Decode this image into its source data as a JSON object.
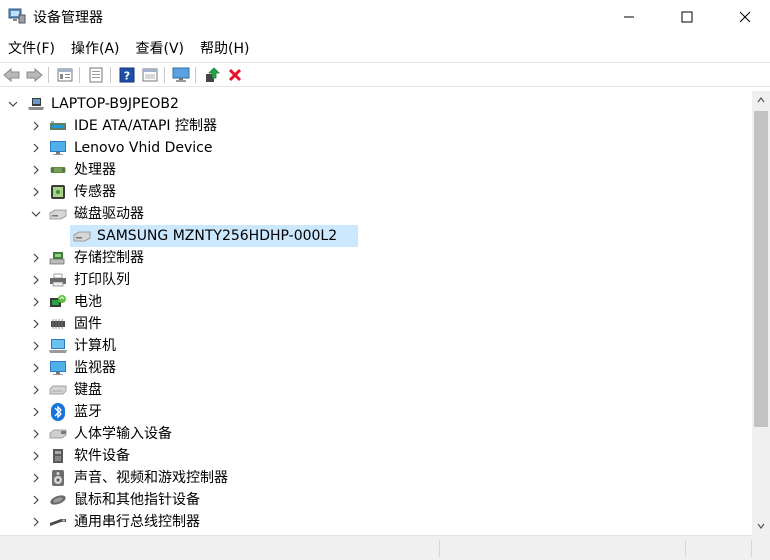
{
  "window": {
    "title": "设备管理器"
  },
  "menu": [
    "文件(F)",
    "操作(A)",
    "查看(V)",
    "帮助(H)"
  ],
  "toolbar_icons": [
    "back-arrow-icon",
    "forward-arrow-icon",
    "properties-icon",
    "show-hide-icon",
    "help-icon",
    "view-icon",
    "computer-icon",
    "update-driver-icon",
    "uninstall-icon"
  ],
  "tree": {
    "root": "LAPTOP-B9JPEOB2",
    "items": [
      {
        "label": "IDE ATA/ATAPI 控制器",
        "icon": "ide-controller-icon",
        "expanded": false
      },
      {
        "label": "Lenovo Vhid Device",
        "icon": "monitor-icon",
        "expanded": false
      },
      {
        "label": "处理器",
        "icon": "processor-icon",
        "expanded": false
      },
      {
        "label": "传感器",
        "icon": "sensor-icon",
        "expanded": false
      },
      {
        "label": "磁盘驱动器",
        "icon": "disk-drive-icon",
        "expanded": true,
        "children": [
          {
            "label": "SAMSUNG MZNTY256HDHP-000L2",
            "icon": "disk-icon",
            "selected": true
          }
        ]
      },
      {
        "label": "存储控制器",
        "icon": "storage-controller-icon",
        "expanded": false
      },
      {
        "label": "打印队列",
        "icon": "printer-icon",
        "expanded": false
      },
      {
        "label": "电池",
        "icon": "battery-icon",
        "expanded": false
      },
      {
        "label": "固件",
        "icon": "firmware-icon",
        "expanded": false
      },
      {
        "label": "计算机",
        "icon": "computer-icon",
        "expanded": false
      },
      {
        "label": "监视器",
        "icon": "monitor-icon",
        "expanded": false
      },
      {
        "label": "键盘",
        "icon": "keyboard-icon",
        "expanded": false
      },
      {
        "label": "蓝牙",
        "icon": "bluetooth-icon",
        "expanded": false
      },
      {
        "label": "人体学输入设备",
        "icon": "hid-icon",
        "expanded": false
      },
      {
        "label": "软件设备",
        "icon": "software-device-icon",
        "expanded": false
      },
      {
        "label": "声音、视频和游戏控制器",
        "icon": "audio-icon",
        "expanded": false
      },
      {
        "label": "鼠标和其他指针设备",
        "icon": "mouse-icon",
        "expanded": false
      },
      {
        "label": "通用串行总线控制器",
        "icon": "usb-icon",
        "expanded": false
      }
    ]
  },
  "colors": {
    "selected": "#cce8ff",
    "uninstall": "#e81123",
    "help": "#1e4fa8"
  }
}
